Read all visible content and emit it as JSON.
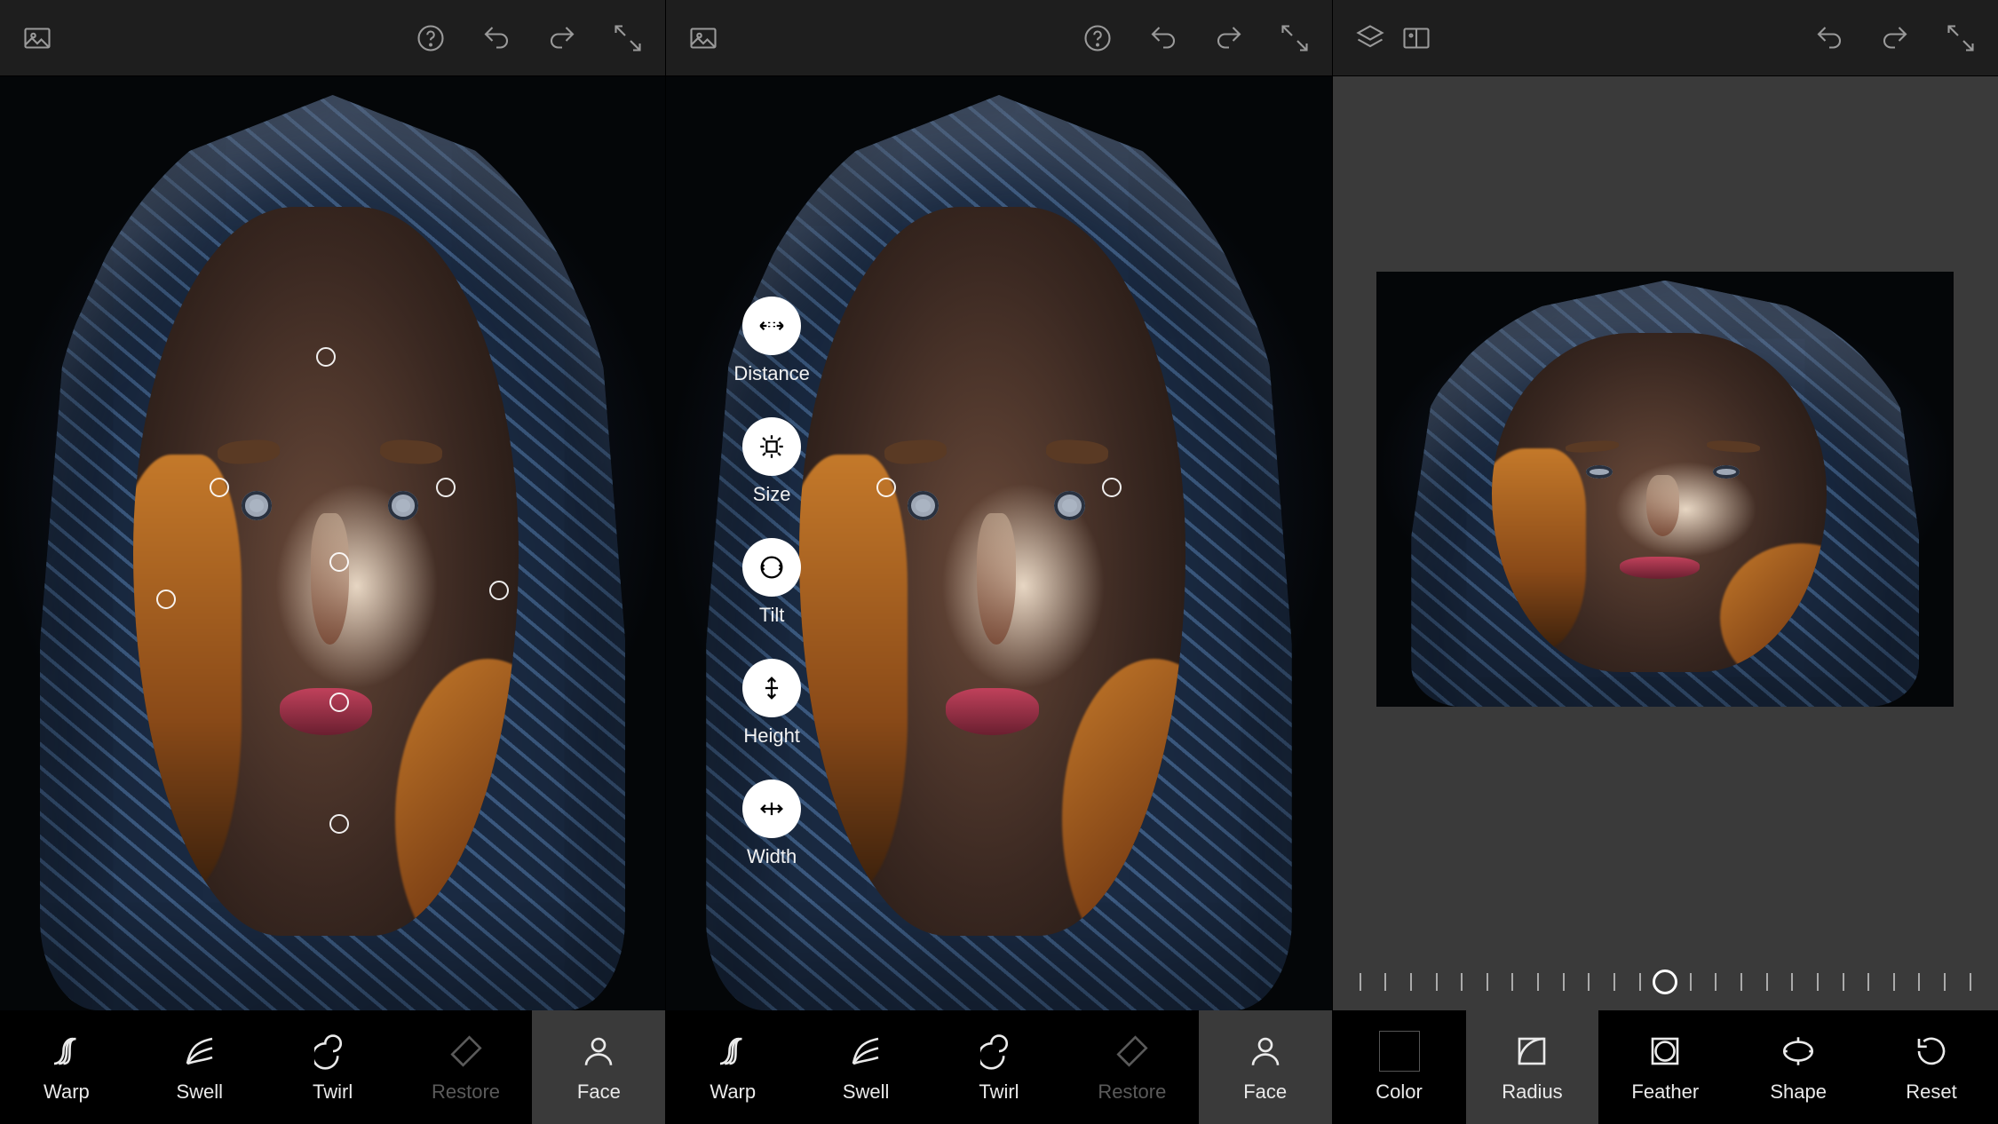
{
  "topbar_icons": {
    "image": "image-icon",
    "help": "help-icon",
    "undo": "undo-icon",
    "redo": "redo-icon",
    "expand": "expand-icon",
    "layers": "layers-icon",
    "compare": "compare-icon"
  },
  "panel1": {
    "tools": [
      {
        "id": "warp",
        "label": "Warp",
        "active": false,
        "disabled": false
      },
      {
        "id": "swell",
        "label": "Swell",
        "active": false,
        "disabled": false
      },
      {
        "id": "twirl",
        "label": "Twirl",
        "active": false,
        "disabled": false
      },
      {
        "id": "restore",
        "label": "Restore",
        "active": false,
        "disabled": true
      },
      {
        "id": "face",
        "label": "Face",
        "active": true,
        "disabled": false
      }
    ],
    "markers": [
      {
        "id": "forehead",
        "x": 49,
        "y": 30
      },
      {
        "id": "eye-left",
        "x": 33,
        "y": 44
      },
      {
        "id": "eye-right",
        "x": 67,
        "y": 44
      },
      {
        "id": "nose",
        "x": 51,
        "y": 52
      },
      {
        "id": "cheek-left",
        "x": 25,
        "y": 56
      },
      {
        "id": "cheek-right",
        "x": 75,
        "y": 55
      },
      {
        "id": "mouth",
        "x": 51,
        "y": 67
      },
      {
        "id": "chin",
        "x": 51,
        "y": 80
      }
    ]
  },
  "panel2": {
    "tools": [
      {
        "id": "warp",
        "label": "Warp",
        "active": false,
        "disabled": false
      },
      {
        "id": "swell",
        "label": "Swell",
        "active": false,
        "disabled": false
      },
      {
        "id": "twirl",
        "label": "Twirl",
        "active": false,
        "disabled": false
      },
      {
        "id": "restore",
        "label": "Restore",
        "active": false,
        "disabled": true
      },
      {
        "id": "face",
        "label": "Face",
        "active": true,
        "disabled": false
      }
    ],
    "markers": [
      {
        "id": "eye-left",
        "x": 33,
        "y": 44
      },
      {
        "id": "eye-right",
        "x": 67,
        "y": 44
      }
    ],
    "face_menu": [
      {
        "id": "distance",
        "label": "Distance"
      },
      {
        "id": "size",
        "label": "Size"
      },
      {
        "id": "tilt",
        "label": "Tilt"
      },
      {
        "id": "height",
        "label": "Height"
      },
      {
        "id": "width",
        "label": "Width"
      }
    ]
  },
  "panel3": {
    "slider": {
      "value": 50,
      "min": 0,
      "max": 100,
      "ticks": 25
    },
    "tools": [
      {
        "id": "color",
        "label": "Color",
        "active": false,
        "disabled": false
      },
      {
        "id": "radius",
        "label": "Radius",
        "active": true,
        "disabled": false
      },
      {
        "id": "feather",
        "label": "Feather",
        "active": false,
        "disabled": false
      },
      {
        "id": "shape",
        "label": "Shape",
        "active": false,
        "disabled": false
      },
      {
        "id": "reset",
        "label": "Reset",
        "active": false,
        "disabled": false
      }
    ]
  }
}
